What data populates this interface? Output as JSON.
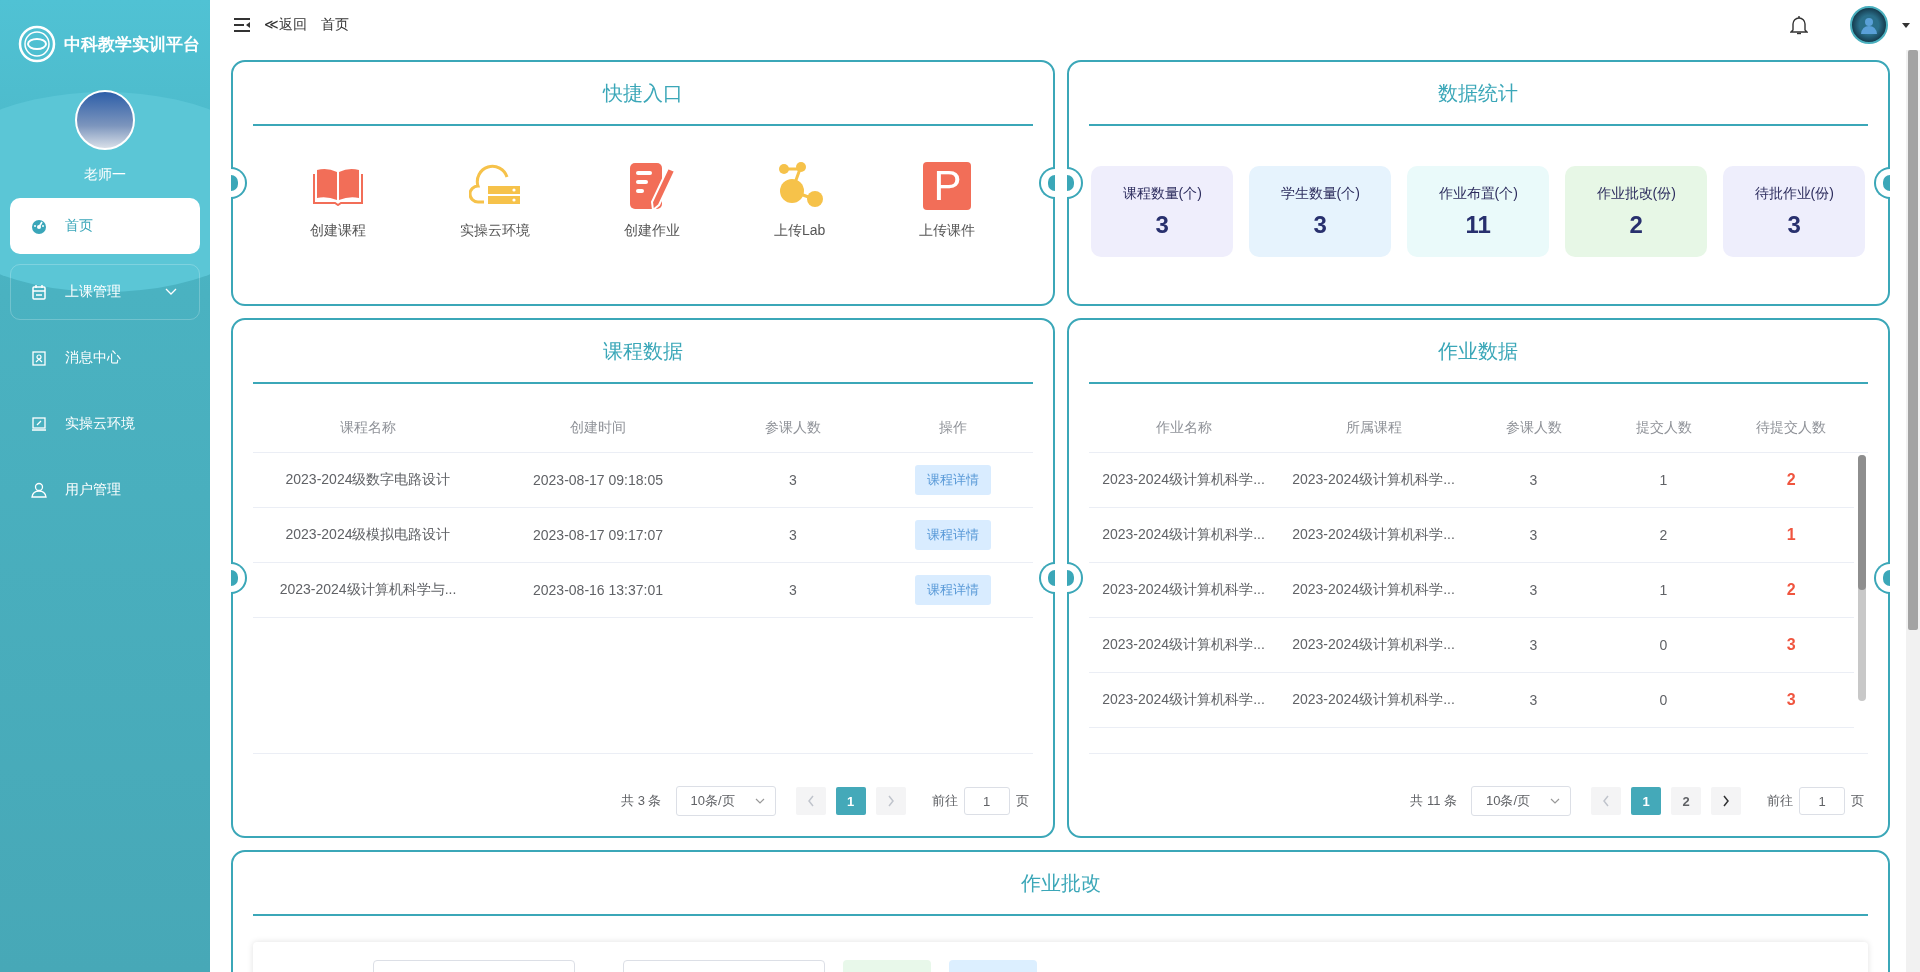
{
  "sidebar": {
    "brand": "中科教学实训平台",
    "user_name": "老师一",
    "items": [
      {
        "label": "首页",
        "kind": "link",
        "selected": true
      },
      {
        "label": "上课管理",
        "kind": "group",
        "selected": false,
        "expanded": false
      },
      {
        "label": "消息中心",
        "kind": "link",
        "selected": false
      },
      {
        "label": "实操云环境",
        "kind": "link",
        "selected": false
      },
      {
        "label": "用户管理",
        "kind": "link",
        "selected": false
      }
    ]
  },
  "topbar": {
    "back": "≪返回",
    "breadcrumb": "首页"
  },
  "quick_entry": {
    "title": "快捷入口",
    "items": [
      {
        "label": "创建课程",
        "kind": "book"
      },
      {
        "label": "实操云环境",
        "kind": "cloud"
      },
      {
        "label": "创建作业",
        "kind": "form"
      },
      {
        "label": "上传Lab",
        "kind": "nodes"
      },
      {
        "label": "上传课件",
        "kind": "slides",
        "glyph": "P"
      }
    ]
  },
  "stats": {
    "title": "数据统计",
    "cards": [
      {
        "label": "课程数量(个)",
        "value": "3",
        "color": "#efeefc"
      },
      {
        "label": "学生数量(个)",
        "value": "3",
        "color": "#e6f3fd"
      },
      {
        "label": "作业布置(个)",
        "value": "11",
        "color": "#eafafa"
      },
      {
        "label": "作业批改(份)",
        "value": "2",
        "color": "#e7f7e6"
      },
      {
        "label": "待批作业(份)",
        "value": "3",
        "color": "#eeeefc"
      }
    ]
  },
  "course_table": {
    "title": "课程数据",
    "columns": [
      {
        "label": "课程名称"
      },
      {
        "label": "创建时间"
      },
      {
        "label": "参课人数"
      },
      {
        "label": "操作"
      }
    ],
    "rows": [
      {
        "name": "2023-2024级数字电路设计",
        "created": "2023-08-17 09:18:05",
        "participants": "3",
        "action": "课程详情"
      },
      {
        "name": "2023-2024级模拟电路设计",
        "created": "2023-08-17 09:17:07",
        "participants": "3",
        "action": "课程详情"
      },
      {
        "name": "2023-2024级计算机科学与...",
        "created": "2023-08-16 13:37:01",
        "participants": "3",
        "action": "课程详情"
      }
    ],
    "pager": {
      "total": "共 3 条",
      "page_size": "10条/页",
      "prev_disabled": true,
      "next_disabled": true,
      "pages": [
        {
          "label": "1",
          "selected": true
        }
      ],
      "goto_label": "前往",
      "goto_value": "1",
      "goto_unit": "页"
    }
  },
  "homework_table": {
    "title": "作业数据",
    "columns": [
      {
        "label": "作业名称"
      },
      {
        "label": "所属课程"
      },
      {
        "label": "参课人数"
      },
      {
        "label": "提交人数"
      },
      {
        "label": "待提交人数"
      }
    ],
    "rows": [
      {
        "name": "2023-2024级计算机科学...",
        "course": "2023-2024级计算机科学...",
        "participants": "3",
        "submitted": "1",
        "pending": "2"
      },
      {
        "name": "2023-2024级计算机科学...",
        "course": "2023-2024级计算机科学...",
        "participants": "3",
        "submitted": "2",
        "pending": "1"
      },
      {
        "name": "2023-2024级计算机科学...",
        "course": "2023-2024级计算机科学...",
        "participants": "3",
        "submitted": "1",
        "pending": "2"
      },
      {
        "name": "2023-2024级计算机科学...",
        "course": "2023-2024级计算机科学...",
        "participants": "3",
        "submitted": "0",
        "pending": "3"
      },
      {
        "name": "2023-2024级计算机科学...",
        "course": "2023-2024级计算机科学...",
        "participants": "3",
        "submitted": "0",
        "pending": "3"
      }
    ],
    "pager": {
      "total": "共 11 条",
      "page_size": "10条/页",
      "prev_disabled": true,
      "next_disabled": false,
      "pages": [
        {
          "label": "1",
          "selected": true
        },
        {
          "label": "2",
          "selected": false
        }
      ],
      "goto_label": "前往",
      "goto_value": "1",
      "goto_unit": "页"
    }
  },
  "grading": {
    "title": "作业批改"
  }
}
